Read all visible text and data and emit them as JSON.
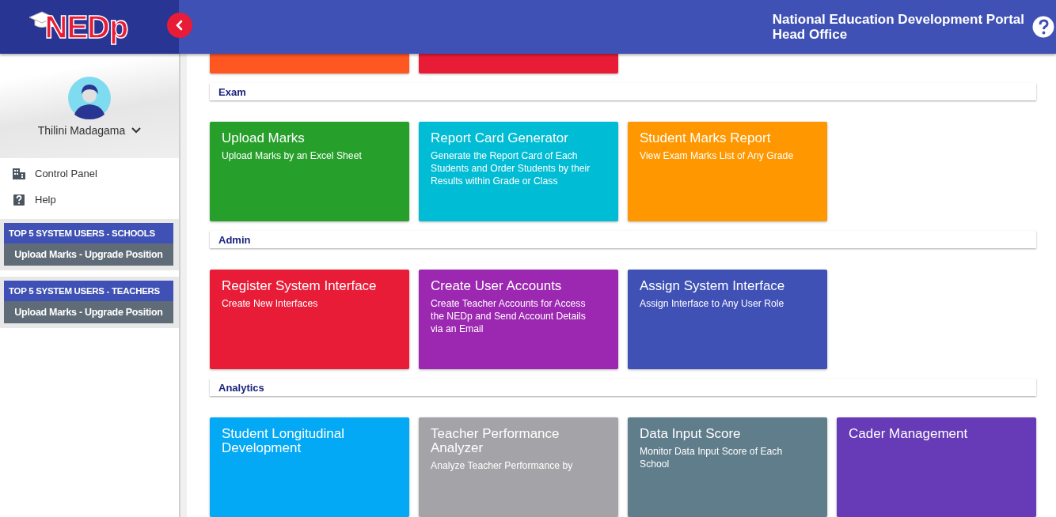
{
  "header": {
    "logo": "NEDp",
    "title": "National Education Development Portal",
    "subtitle": "Head Office"
  },
  "sidebar": {
    "user": "Thilini Madagama",
    "menu": [
      {
        "label": "Control Panel",
        "kind": "panel"
      },
      {
        "label": "Help",
        "kind": "help"
      }
    ],
    "widgets": [
      {
        "title": "TOP 5 SYSTEM USERS - SCHOOLS",
        "action": "Upload Marks - Upgrade Position"
      },
      {
        "title": "TOP 5 SYSTEM USERS - TEACHERS",
        "action": "Upload Marks - Upgrade Position"
      }
    ]
  },
  "top_tiles": [
    {
      "color": "#ff5722"
    },
    {
      "color": "#e91c37"
    }
  ],
  "sections": [
    {
      "title": "Exam",
      "tiles": [
        {
          "title": "Upload Marks",
          "description": "Upload Marks by an Excel Sheet",
          "color": "#26a02a"
        },
        {
          "title": "Report Card Generator",
          "description": "Generate the Report Card of Each Students and Order Students by their Results within Grade or Class",
          "color": "#00bcd4"
        },
        {
          "title": "Student Marks Report",
          "description": "View Exam Marks List of Any Grade",
          "color": "#ff9800"
        }
      ]
    },
    {
      "title": "Admin",
      "tiles": [
        {
          "title": "Register System Interface",
          "description": "Create New Interfaces",
          "color": "#e91c37"
        },
        {
          "title": "Create User Accounts",
          "description": "Create Teacher Accounts for Access the NEDp and Send Account Details via an Email",
          "color": "#9c27b0"
        },
        {
          "title": "Assign System Interface",
          "description": "Assign Interface to Any User Role",
          "color": "#3f51b5"
        }
      ]
    },
    {
      "title": "Analytics",
      "tiles": [
        {
          "title": "Student Longitudinal Development",
          "color": "#03a9f4"
        },
        {
          "title": "Teacher Performance Analyzer",
          "description": "Analyze Teacher Performance by",
          "color": "#a4a4a8"
        },
        {
          "title": "Data Input Score",
          "description": "Monitor Data Input Score of Each School",
          "color": "#607d8b"
        },
        {
          "title": "Cader Management",
          "color": "#673ab7"
        }
      ]
    }
  ]
}
